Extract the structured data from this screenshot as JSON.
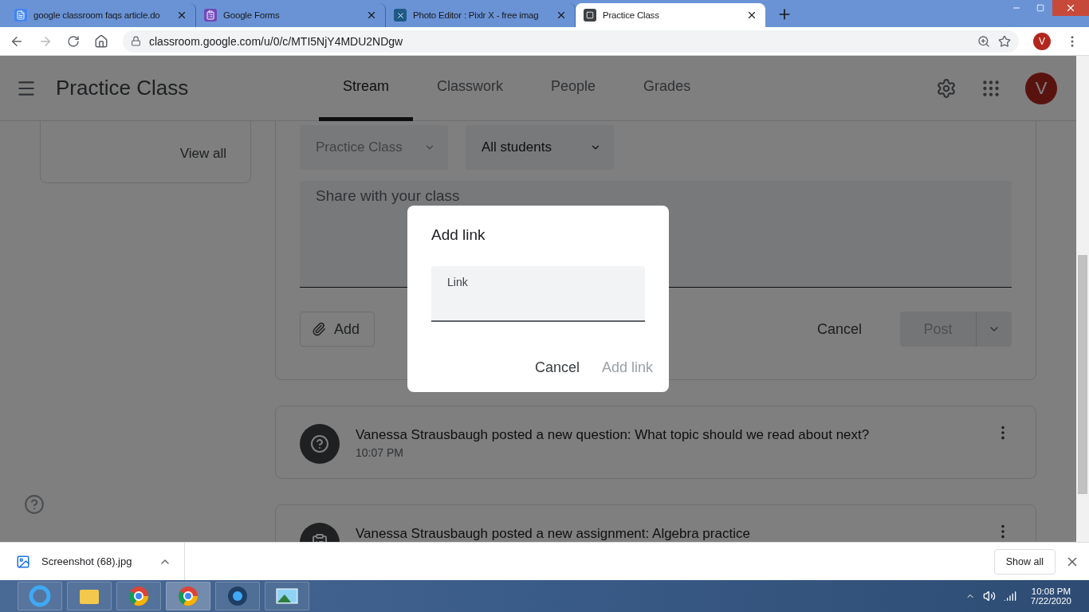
{
  "browser_tabs": [
    {
      "title": "google classroom faqs article.do",
      "kind": "docs",
      "selected": false
    },
    {
      "title": "Google Forms",
      "kind": "forms",
      "selected": false
    },
    {
      "title": "Photo Editor : Pixlr X - free imag",
      "kind": "pixlr",
      "selected": false
    },
    {
      "title": "Practice Class",
      "kind": "classroom",
      "selected": true
    }
  ],
  "address_bar": {
    "url": "classroom.google.com/u/0/c/MTI5NjY4MDU2NDgw",
    "profile_initial": "V"
  },
  "header": {
    "title": "Practice Class",
    "tabs": [
      {
        "label": "Stream",
        "selected": true
      },
      {
        "label": "Classwork",
        "selected": false
      },
      {
        "label": "People",
        "selected": false
      },
      {
        "label": "Grades",
        "selected": false
      }
    ],
    "avatar_initial": "V"
  },
  "sidebar": {
    "link": "View all"
  },
  "composer": {
    "class_select": "Practice Class",
    "audience_select": "All students",
    "placeholder": "Share with your class",
    "add_button": "Add",
    "cancel_button": "Cancel",
    "post_button": "Post"
  },
  "posts": [
    {
      "kind": "question",
      "text": "Vanessa Strausbaugh posted a new question: What topic should we read about next?",
      "time": "10:07 PM"
    },
    {
      "kind": "assignment",
      "text": "Vanessa Strausbaugh posted a new assignment: Algebra practice"
    }
  ],
  "dialog": {
    "title": "Add link",
    "field_label": "Link",
    "cancel": "Cancel",
    "confirm": "Add link",
    "confirm_disabled": true
  },
  "download_bar": {
    "file": "Screenshot (68).jpg",
    "show_all": "Show all"
  },
  "taskbar": {
    "time": "10:08 PM",
    "date": "7/22/2020"
  }
}
